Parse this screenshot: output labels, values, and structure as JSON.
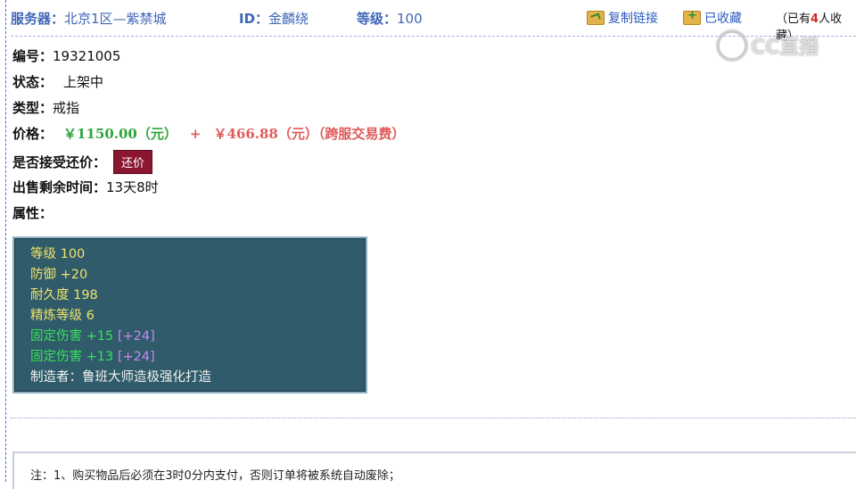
{
  "topbar": {
    "server_label": "服务器：",
    "server_value": "北京1区—紫禁城",
    "id_label": "ID：",
    "id_value": "金麟绕",
    "level_label": "等级：",
    "level_value": "100",
    "copy_link": "复制链接",
    "favorited": "已收藏",
    "fav_prefix": "（已有",
    "fav_count": "4",
    "fav_suffix": "人收藏）"
  },
  "watermark": {
    "text": "CC直播"
  },
  "details": {
    "number_label": "编号：",
    "number_value": "19321005",
    "status_label": "状态：",
    "status_value": "上架中",
    "type_label": "类型：",
    "type_value": "戒指",
    "price_label": "价格：",
    "price_main": "￥1150.00（元）",
    "price_plus": "+",
    "price_fee": "￥466.88（元）（跨服交易费）",
    "bargain_label": "是否接受还价：",
    "bargain_button": "还价",
    "remaining_label": "出售剩余时间：",
    "remaining_value": "13天8时",
    "attr_label": "属性："
  },
  "attributes": [
    {
      "text": "等级 100",
      "color": "#f0e36a"
    },
    {
      "text": "防御 +20",
      "color": "#f0e36a"
    },
    {
      "text": "耐久度 198",
      "color": "#f0e36a"
    },
    {
      "text": "精炼等级 6",
      "color": "#f0e36a"
    },
    {
      "text": "固定伤害 +15",
      "extra": "[+24]",
      "color": "#38e05a",
      "extra_color": "#c887f0"
    },
    {
      "text": "固定伤害 +13",
      "extra": "[+24]",
      "color": "#38e05a",
      "extra_color": "#c887f0"
    },
    {
      "text": "制造者：鲁班大师造极强化打造",
      "color": "#f2f2f2"
    }
  ],
  "notice": {
    "text": "注：1、购买物品后必须在3时0分内支付，否则订单将被系统自动废除；"
  }
}
